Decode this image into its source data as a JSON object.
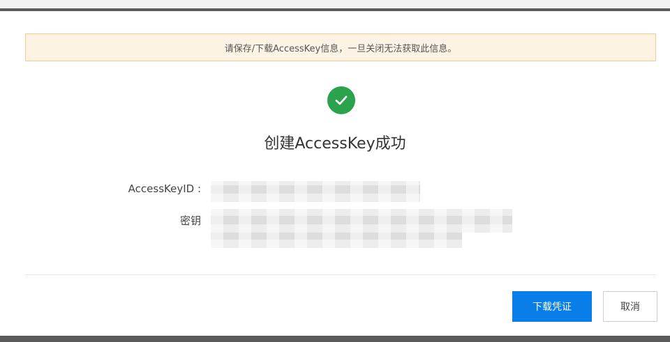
{
  "notice": {
    "text": "请保存/下载AccessKey信息，一旦关闭无法获取此信息。"
  },
  "result": {
    "title": "创建AccessKey成功",
    "icon": "success-check-icon"
  },
  "fields": {
    "access_key_id_label": "AccessKeyID :",
    "secret_label": "密钥"
  },
  "actions": {
    "download_label": "下载凭证",
    "cancel_label": "取消"
  },
  "colors": {
    "notice_border": "#f5c98e",
    "notice_bg": "#fdf3e4",
    "success": "#2ba24c",
    "primary": "#0a7ee8"
  }
}
